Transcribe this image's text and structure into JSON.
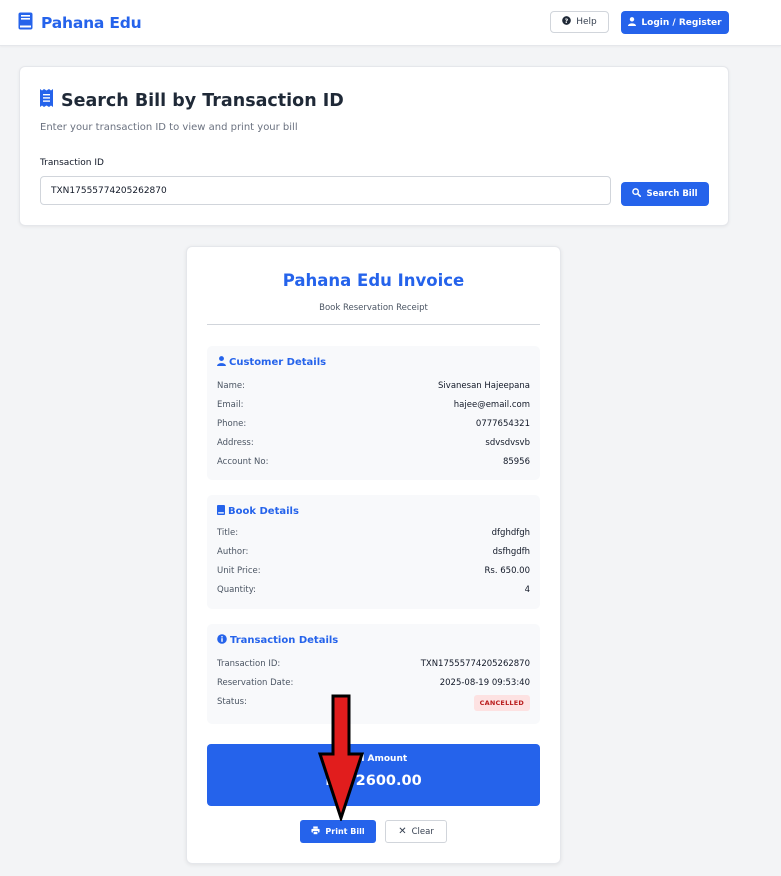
{
  "header": {
    "brand": "Pahana Edu",
    "help_label": "Help",
    "login_label": "Login / Register"
  },
  "search": {
    "title": "Search Bill by Transaction ID",
    "subtitle": "Enter your transaction ID to view and print your bill",
    "field_label": "Transaction ID",
    "value": "TXN17555774205262870",
    "button_label": "Search Bill"
  },
  "invoice": {
    "title": "Pahana Edu Invoice",
    "subtitle": "Book Reservation Receipt",
    "customer": {
      "heading": "Customer Details",
      "rows": [
        {
          "label": "Name:",
          "value": "Sivanesan Hajeepana"
        },
        {
          "label": "Email:",
          "value": "hajee@email.com"
        },
        {
          "label": "Phone:",
          "value": "0777654321"
        },
        {
          "label": "Address:",
          "value": "sdvsdvsvb"
        },
        {
          "label": "Account No:",
          "value": "85956"
        }
      ]
    },
    "book": {
      "heading": "Book Details",
      "rows": [
        {
          "label": "Title:",
          "value": "dfghdfgh"
        },
        {
          "label": "Author:",
          "value": "dsfhgdfh"
        },
        {
          "label": "Unit Price:",
          "value": "Rs. 650.00"
        },
        {
          "label": "Quantity:",
          "value": "4"
        }
      ]
    },
    "transaction": {
      "heading": "Transaction Details",
      "rows": [
        {
          "label": "Transaction ID:",
          "value": "TXN17555774205262870"
        },
        {
          "label": "Reservation Date:",
          "value": "2025-08-19 09:53:40"
        }
      ],
      "status_label": "Status:",
      "status_value": "CANCELLED"
    },
    "total_label": "Total Amount",
    "total_value": "Rs. 2600.00",
    "print_label": "Print Bill",
    "clear_label": "Clear"
  },
  "colors": {
    "accent": "#2563eb",
    "annotation_arrow": "#e11d1d",
    "status_bg": "#fde2e2",
    "status_text": "#b91c1c"
  },
  "annotation": {
    "arrow": "down-arrow-pointing-at-print-bill"
  }
}
